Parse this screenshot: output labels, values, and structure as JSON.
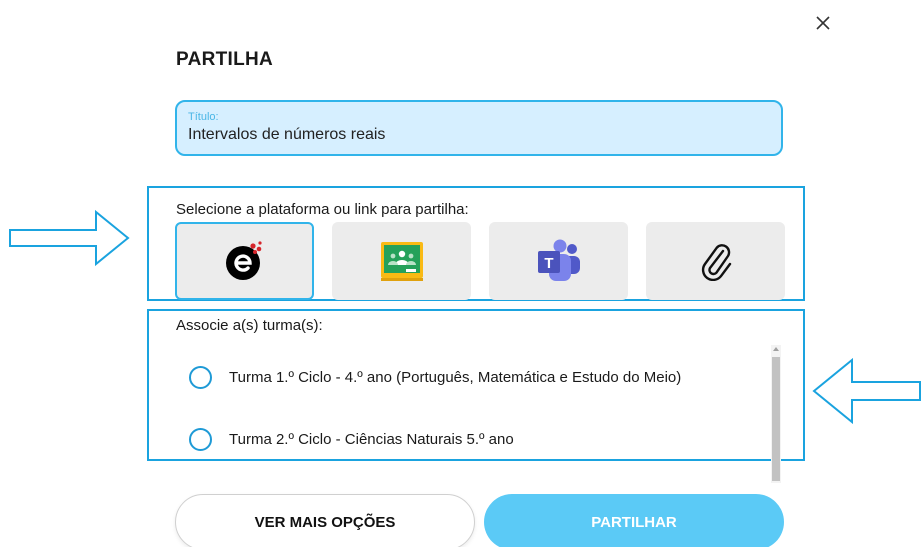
{
  "dialog": {
    "title": "PARTILHA",
    "title_field": {
      "label": "Título:",
      "value": "Intervalos de números reais"
    },
    "platform_label": "Selecione a plataforma ou link para partilha:",
    "platforms": [
      {
        "name": "escola-virtual",
        "icon": "escola-virtual-logo",
        "selected": true
      },
      {
        "name": "google-classroom",
        "icon": "google-classroom-icon",
        "selected": false
      },
      {
        "name": "microsoft-teams",
        "icon": "teams-icon",
        "selected": false
      },
      {
        "name": "link",
        "icon": "paperclip-icon",
        "selected": false
      }
    ],
    "classes_label": "Associe a(s) turma(s):",
    "classes": [
      {
        "label": "Turma 1.º Ciclo - 4.º ano (Português, Matemática e Estudo do Meio)",
        "checked": false
      },
      {
        "label": "Turma 2.º Ciclo - Ciências Naturais 5.º ano",
        "checked": false
      }
    ],
    "buttons": {
      "more_options": "VER MAIS OPÇÕES",
      "share": "PARTILHAR"
    }
  },
  "colors": {
    "accent": "#31b4ea",
    "highlight_box": "#1aa3df",
    "title_field_bg": "#d6efff",
    "share_button": "#5bcaf6"
  }
}
